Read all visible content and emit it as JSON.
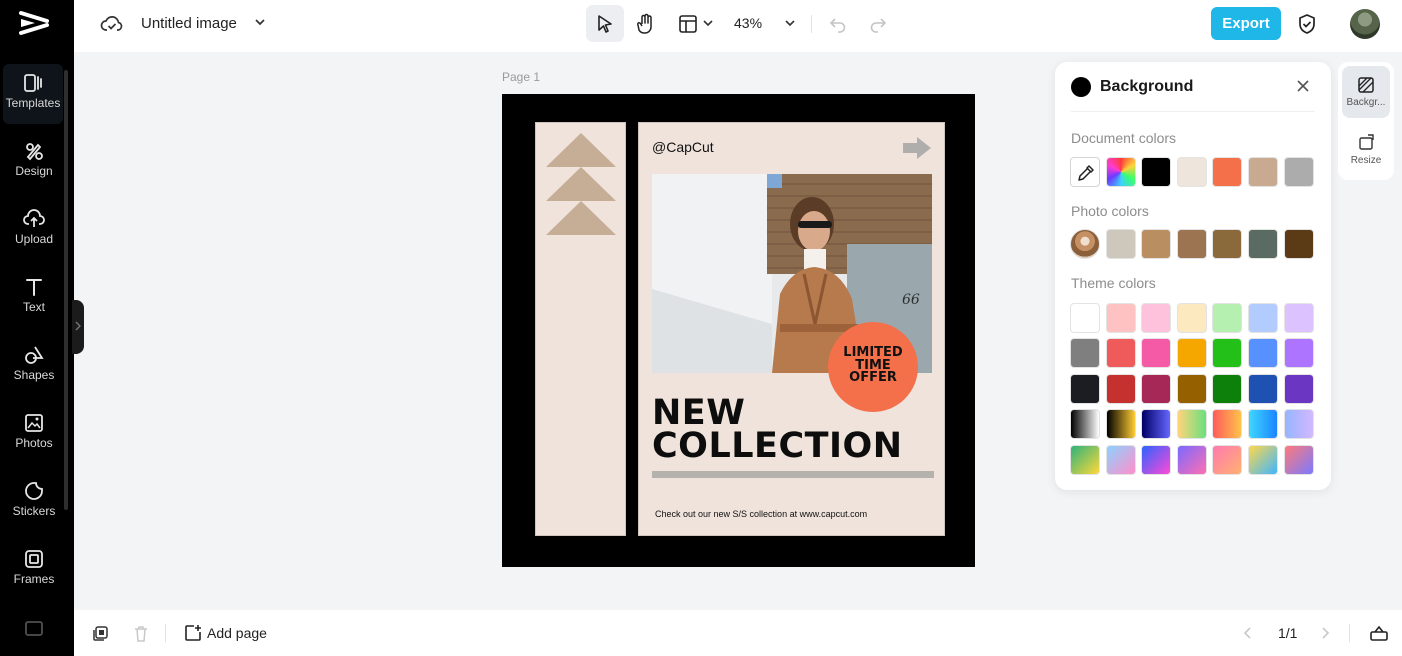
{
  "sidebar": {
    "items": [
      {
        "label": "Templates",
        "icon": "templates-icon"
      },
      {
        "label": "Design",
        "icon": "design-icon"
      },
      {
        "label": "Upload",
        "icon": "upload-icon"
      },
      {
        "label": "Text",
        "icon": "text-icon"
      },
      {
        "label": "Shapes",
        "icon": "shapes-icon"
      },
      {
        "label": "Photos",
        "icon": "photos-icon"
      },
      {
        "label": "Stickers",
        "icon": "stickers-icon"
      },
      {
        "label": "Frames",
        "icon": "frames-icon"
      }
    ]
  },
  "topbar": {
    "title": "Untitled image",
    "zoom": "43%",
    "export_label": "Export"
  },
  "canvas": {
    "page_label": "Page 1",
    "design": {
      "handle": "@CapCut",
      "badge_lines": [
        "LIMITED",
        "TIME",
        "OFFER"
      ],
      "headline_1": "NEW",
      "headline_2": "COLLECTION",
      "tagline": "Check out our new S/S collection at www.capcut.com",
      "door_number": "66"
    }
  },
  "background_panel": {
    "title": "Background",
    "document_colors_label": "Document colors",
    "document_colors": [
      "#000000",
      "#eee6dd",
      "#f4704a",
      "#c8aa91",
      "#acacac"
    ],
    "photo_colors_label": "Photo colors",
    "photo_colors": [
      "#cdc7bc",
      "#b98f62",
      "#9c7451",
      "#8a6a3a",
      "#5a6b61",
      "#5b3a16"
    ],
    "theme_colors_label": "Theme colors",
    "theme_colors": [
      [
        "#ffffff",
        "#ffc2c2",
        "#ffc2dd",
        "#fde9bf",
        "#b6f0b0",
        "#b3ccff",
        "#dcc3ff"
      ],
      [
        "#7f7f7f",
        "#ef5a5a",
        "#f45aa5",
        "#f5a700",
        "#23c01a",
        "#5790ff",
        "#ad74ff"
      ],
      [
        "#1b1d22",
        "#c4312e",
        "#a62856",
        "#946000",
        "#0d7f0b",
        "#1f51b2",
        "#6b37c2"
      ]
    ],
    "gradient_colors": [
      [
        "#000000",
        "#ffffff"
      ],
      [
        "#000000",
        "#ffcc33"
      ],
      [
        "#000066",
        "#6666ff"
      ],
      [
        "#ffd47a",
        "#69e07e"
      ],
      [
        "#ff5b5b",
        "#ffc24a"
      ],
      [
        "#3fd6ff",
        "#1b85ff"
      ],
      [
        "#96b5ff",
        "#d2b8ff"
      ],
      [
        "#2db27a",
        "#ffd83a"
      ],
      [
        "#8ed1ff",
        "#ff8ec9"
      ],
      [
        "#2b63ff",
        "#ff4ad6"
      ],
      [
        "#7a69ff",
        "#ff6fb2"
      ],
      [
        "#ff7ab0",
        "#ffb070"
      ],
      [
        "#ffd84a",
        "#3fb5ff"
      ],
      [
        "#ff7a7a",
        "#7a7aff"
      ]
    ]
  },
  "right_strip": {
    "background_label": "Backgr...",
    "resize_label": "Resize"
  },
  "bottombar": {
    "add_page_label": "Add page",
    "page_indicator": "1/1"
  }
}
